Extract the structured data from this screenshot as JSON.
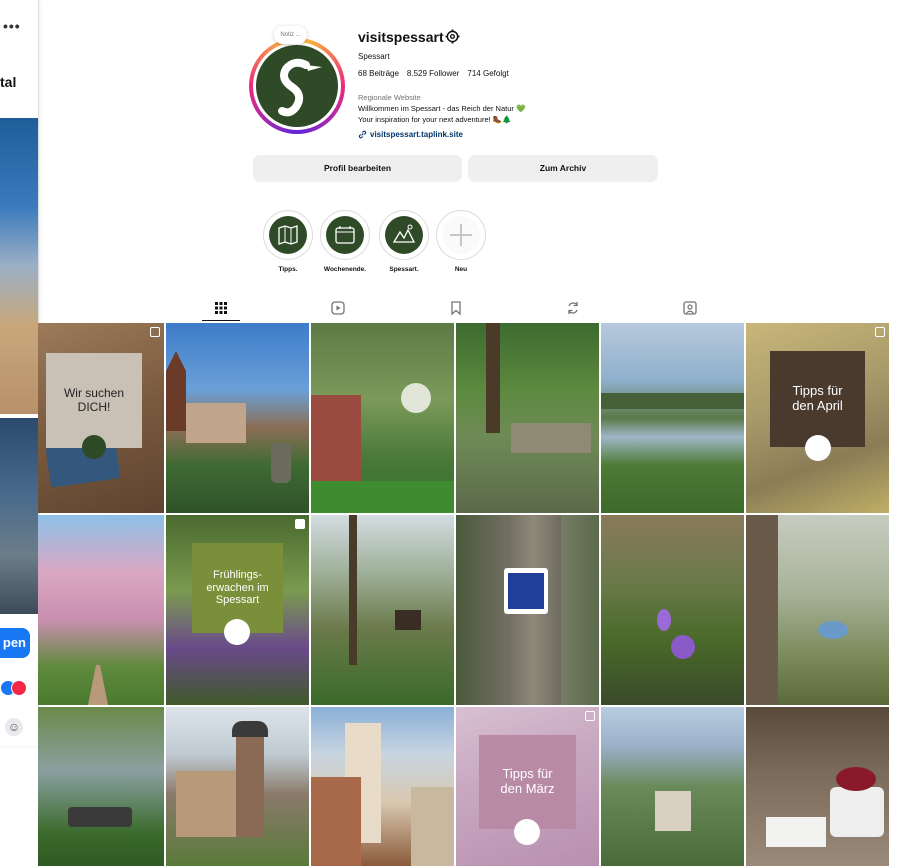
{
  "left_window": {
    "dots": "•••",
    "partial_title": "tal",
    "partial_button": "pen",
    "reaction_icons": [
      "like-reaction-icon",
      "love-reaction-icon"
    ],
    "smiley_icon": "smiley-icon"
  },
  "profile": {
    "note_text": "Notiz ...",
    "username": "visitspessart",
    "settings_icon": "gear-icon",
    "full_name": "Spessart",
    "stats": {
      "posts": "68 Beiträge",
      "followers": "8.529 Follower",
      "following": "714 Gefolgt"
    },
    "category": "Regionale Website",
    "bio_line1": "Willkommen im Spessart - das Reich der Natur 💚",
    "bio_line2": "Your inspiration for your next adventure! 🥾🌲",
    "link_icon": "link-icon",
    "link": "visitspessart.taplink.site",
    "buttons": {
      "edit": "Profil bearbeiten",
      "archive": "Zum Archiv"
    },
    "brand_color": "#2f4a27"
  },
  "highlights": [
    {
      "label": "Tipps.",
      "icon": "map-icon"
    },
    {
      "label": "Wochenende.",
      "icon": "calendar-icon"
    },
    {
      "label": "Spessart.",
      "icon": "landscape-icon"
    },
    {
      "label": "Neu",
      "icon": "plus-icon"
    }
  ],
  "tabs": [
    {
      "name": "posts",
      "icon": "grid-icon",
      "active": true
    },
    {
      "name": "reels",
      "icon": "reels-icon",
      "active": false
    },
    {
      "name": "saved",
      "icon": "bookmark-icon",
      "active": false
    },
    {
      "name": "remixes",
      "icon": "repost-icon",
      "active": false
    },
    {
      "name": "tagged",
      "icon": "tagged-icon",
      "active": false
    }
  ],
  "posts": [
    {
      "type": "card",
      "text": "Wir suchen DICH!",
      "badge": "multi"
    },
    {
      "type": "photo",
      "subject": "church-and-houses"
    },
    {
      "type": "photo",
      "subject": "blossom-branch"
    },
    {
      "type": "photo",
      "subject": "forest-ruins"
    },
    {
      "type": "photo",
      "subject": "lake-view"
    },
    {
      "type": "card",
      "text": "Tipps für den April",
      "badge": "multi"
    },
    {
      "type": "photo",
      "subject": "magnolia-trees"
    },
    {
      "type": "card",
      "text": "Frühlings-erwachen im Spessart",
      "badge": "reel"
    },
    {
      "type": "photo",
      "subject": "forest-hut"
    },
    {
      "type": "photo",
      "subject": "trail-sign"
    },
    {
      "type": "photo",
      "subject": "crocus-flower"
    },
    {
      "type": "photo",
      "subject": "bird-on-branch"
    },
    {
      "type": "photo",
      "subject": "bikes-by-lake"
    },
    {
      "type": "photo",
      "subject": "water-castle"
    },
    {
      "type": "photo",
      "subject": "timber-town"
    },
    {
      "type": "card",
      "text": "Tipps für den März",
      "badge": "multi"
    },
    {
      "type": "photo",
      "subject": "valley-town"
    },
    {
      "type": "photo",
      "subject": "cheese-platter"
    }
  ]
}
